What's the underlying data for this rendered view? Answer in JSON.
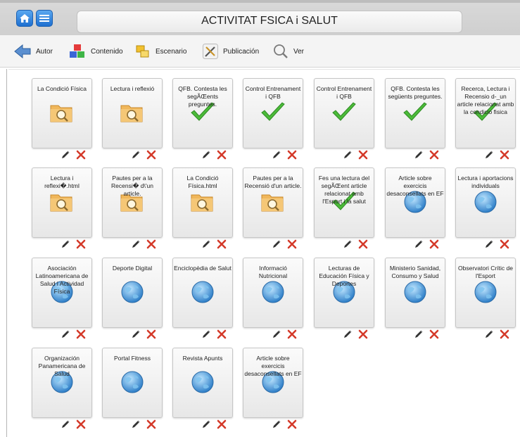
{
  "header": {
    "title": "ACTIVITAT FSICA i SALUT"
  },
  "toolbar": {
    "autor": "Autor",
    "contenido": "Contenido",
    "escenario": "Escenario",
    "publicacion": "Publicación",
    "ver": "Ver"
  },
  "cards": [
    {
      "label": "La Condició Física",
      "icon": "folder-search-icon"
    },
    {
      "label": "Lectura i reflexió",
      "icon": "folder-search-icon"
    },
    {
      "label": "QFB. Contesta les segÃŒents preguntes.",
      "icon": "check-icon"
    },
    {
      "label": "Control Entrenament i QFB",
      "icon": "check-icon"
    },
    {
      "label": "Control Entrenament i QFB",
      "icon": "check-icon"
    },
    {
      "label": "QFB. Contesta les següents preguntes.",
      "icon": "check-icon"
    },
    {
      "label": "Recerca, Lectura i Recensio d-_un article relacionat amb la condicio fisica",
      "icon": "check-icon"
    },
    {
      "label": "Lectura i reflexi�.html",
      "icon": "folder-search-icon"
    },
    {
      "label": "Pautes per a la Recensi� d\\'un article.",
      "icon": "folder-search-icon"
    },
    {
      "label": "La Condició Física.html",
      "icon": "folder-search-icon"
    },
    {
      "label": "Pautes per a la Recensió d'un article.",
      "icon": "folder-search-icon"
    },
    {
      "label": "Fes una lectura del segÃŒent article relacionat amb l'Esport i la salut",
      "icon": "check-icon"
    },
    {
      "label": "Article sobre exercicis desaconsellats en EF",
      "icon": "globe-icon"
    },
    {
      "label": "Lectura i aportacions individuals",
      "icon": "globe-icon"
    },
    {
      "label": "Asociación Latinoamericana de Salud i Actividad Física",
      "icon": "globe-icon"
    },
    {
      "label": "Deporte Digital",
      "icon": "globe-icon"
    },
    {
      "label": "Enciclopèdia de Salut",
      "icon": "globe-icon"
    },
    {
      "label": "Informació Nutricional",
      "icon": "globe-icon"
    },
    {
      "label": "Lecturas de Educación Física y Deportes",
      "icon": "globe-icon"
    },
    {
      "label": "Ministerio Sanidad, Consumo y Salud",
      "icon": "globe-icon"
    },
    {
      "label": "Observatori Crític de l'Esport",
      "icon": "globe-icon"
    },
    {
      "label": "Organización Panamericana de Salud",
      "icon": "globe-icon"
    },
    {
      "label": "Portal Fitness",
      "icon": "globe-icon"
    },
    {
      "label": "Revista Apunts",
      "icon": "globe-icon"
    },
    {
      "label": "Article sobre exercicis desaconsellats en EF",
      "icon": "globe-icon"
    }
  ]
}
